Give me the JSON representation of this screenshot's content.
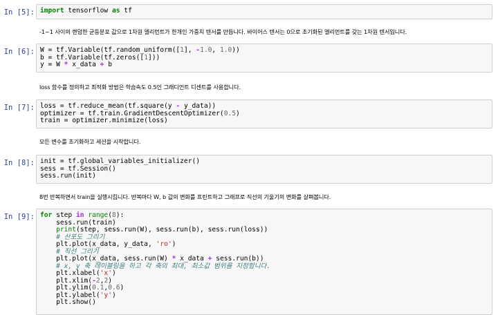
{
  "cells": [
    {
      "prompt": "In [5]:",
      "lines": [
        [
          "import",
          " tensorflow ",
          "as",
          " tf"
        ]
      ]
    },
    {
      "prompt": "In [6]:"
    },
    {
      "prompt": "In [7]:"
    },
    {
      "prompt": "In [8]:"
    },
    {
      "prompt": "In [9]:"
    }
  ],
  "markdown": {
    "m1": "-1~1 사이의 랜덤한 균등분포 값으로 1차원 엘리먼트가 한개인 가중치 텐서를 만듭니다. 바이어스 텐서는 0으로 초기화된 엘리먼트를 갖는 1차원 텐서입니다.",
    "m2": "loss 함수를 정의하고 최적화 방법은 학습속도 0.5인 그래디언트 디센트를 사용합니다.",
    "m3": "모든 변수를 초기화하고 세션을 시작합니다.",
    "m4": "8번 반복하면서 train을 실행시킵니다. 반복마다 W, b 값의 변화를 프린트하고 그래프로 직선의 기울기의 변화를 살펴봅니다."
  },
  "code": {
    "c5": {
      "kw1": "import",
      "t1": " tensorflow ",
      "kw2": "as",
      "t2": " tf"
    },
    "c6": {
      "l1a": "W = tf.Variable(tf.random_uniform([",
      "l1n1": "1",
      "l1b": "], ",
      "l1op": "-",
      "l1n2": "1.0",
      "l1c": ", ",
      "l1n3": "1.0",
      "l1d": "))",
      "l2a": "b = tf.Variable(tf.zeros([",
      "l2n": "1",
      "l2b": "]))",
      "l3a": "y = W ",
      "l3op": "*",
      "l3b": " x_data ",
      "l3op2": "+",
      "l3c": " b"
    },
    "c7": {
      "l1a": "loss = tf.reduce_mean(tf.square(y ",
      "l1op": "-",
      "l1b": " y_data))",
      "l2a": "optimizer = tf.train.GradientDescentOptimizer(",
      "l2n": "0.5",
      "l2b": ")",
      "l3": "train = optimizer.minimize(loss)"
    },
    "c8": {
      "l1": "init = tf.global_variables_initializer()",
      "l2": "sess = tf.Session()",
      "l3": "sess.run(init)"
    },
    "c9": {
      "l1kw": "for",
      "l1a": " step ",
      "l1kw2": "in",
      "l1sp": " ",
      "l1bi": "range",
      "l1b": "(",
      "l1n": "8",
      "l1c": "):",
      "l2": "    sess.run(train)",
      "l3sp": "    ",
      "l3bi": "print",
      "l3a": "(step, sess.run(W), sess.run(b), sess.run(loss))",
      "l4": "    # 산포도 그리기",
      "l5a": "    plt.plot(x_data, y_data, ",
      "l5s": "'ro'",
      "l5b": ")",
      "l6": "    # 직선 그리기",
      "l7a": "    plt.plot(x_data, sess.run(W) ",
      "l7op": "*",
      "l7b": " x_data ",
      "l7op2": "+",
      "l7c": " sess.run(b))",
      "l8": "    # x, y 축 레이블링을 하고 각 축의 최대, 최소값 범위를 지정합니다.",
      "l9a": "    plt.xlabel(",
      "l9s": "'x'",
      "l9b": ")",
      "l10a": "    plt.xlim(",
      "l10op": "-",
      "l10n1": "2",
      "l10c": ",",
      "l10n2": "2",
      "l10b": ")",
      "l11a": "    plt.ylim(",
      "l11n1": "0.1",
      "l11c": ",",
      "l11n2": "0.6",
      "l11b": ")",
      "l12a": "    plt.ylabel(",
      "l12s": "'y'",
      "l12b": ")",
      "l13": "    plt.show()"
    }
  },
  "prompts": {
    "p5": "In [5]:",
    "p6": "In [6]:",
    "p7": "In [7]:",
    "p8": "In [8]:",
    "p9": "In [9]:"
  }
}
